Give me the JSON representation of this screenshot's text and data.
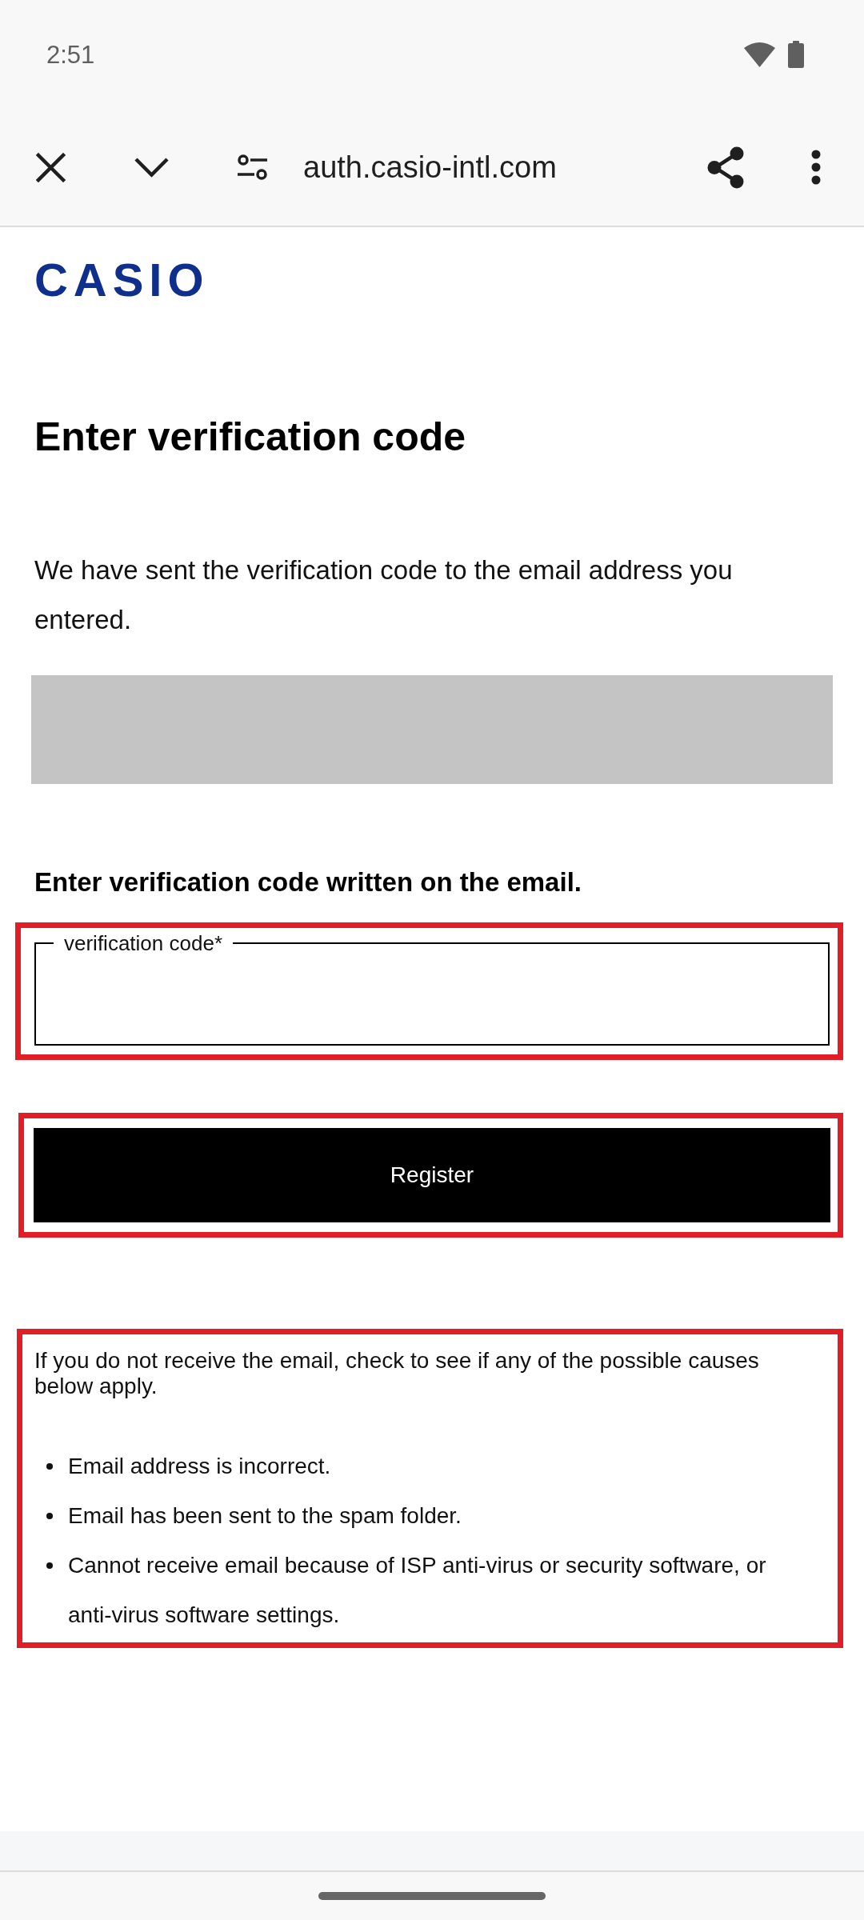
{
  "status_bar": {
    "time": "2:51"
  },
  "browser_toolbar": {
    "url": "auth.casio-intl.com"
  },
  "page": {
    "logo": "CASIO",
    "title": "Enter verification code",
    "intro": "We have sent the verification code to the email address you entered.",
    "prompt": "Enter verification code written on the email.",
    "code_field": {
      "label": "verification code*",
      "highlighted": true
    },
    "register_button": {
      "label": "Register",
      "highlighted": true
    },
    "help": {
      "highlighted": true,
      "text": "If you do not receive the email, check to see if any of the possible causes below apply.",
      "causes": [
        "Email address is incorrect.",
        "Email has been sent to the spam folder.",
        "Cannot receive email because of ISP anti-virus or security software, or anti-virus software settings."
      ]
    }
  }
}
